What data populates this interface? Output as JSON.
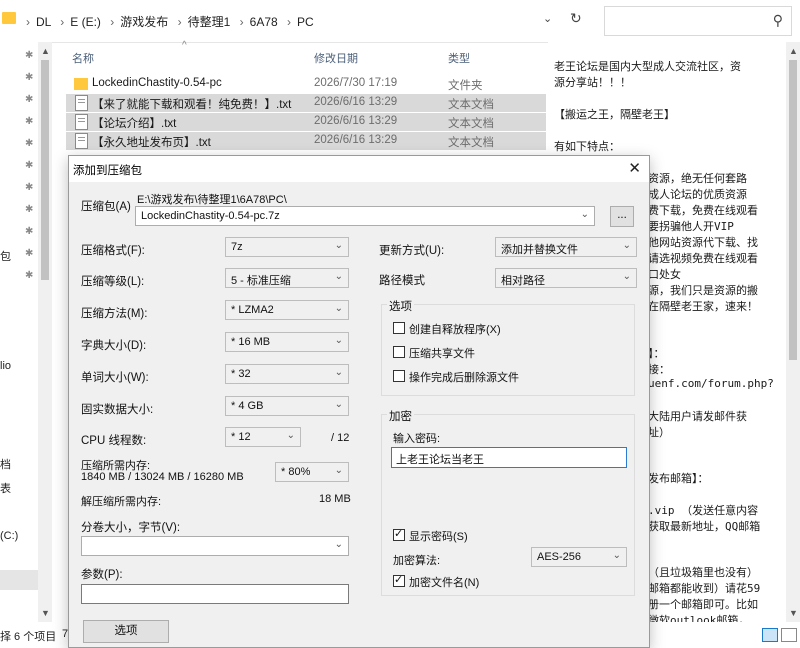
{
  "explorer": {
    "breadcrumb": [
      "DL",
      "E (E:)",
      "游戏发布",
      "待整理1",
      "6A78",
      "PC"
    ],
    "columns": {
      "name": "名称",
      "date": "修改日期",
      "type": "类型"
    },
    "files": [
      {
        "name": "LockedinChastity-0.54-pc",
        "date": "2026/7/30 17:19",
        "type": "文件夹",
        "kind": "folder",
        "selected": false
      },
      {
        "name": "【来了就能下载和观看！纯免费！】.txt",
        "date": "2026/6/16 13:29",
        "type": "文本文档",
        "kind": "txt",
        "selected": true
      },
      {
        "name": "【论坛介绍】.txt",
        "date": "2026/6/16 13:29",
        "type": "文本文档",
        "kind": "txt",
        "selected": true
      },
      {
        "name": "【永久地址发布页】.txt",
        "date": "2026/6/16 13:29",
        "type": "文本文档",
        "kind": "txt",
        "selected": true
      }
    ],
    "left_pane_fragments": [
      "包",
      "lio",
      "档",
      "表",
      "(C:)"
    ],
    "status": {
      "count": "择 6 个项目",
      "extra": "7"
    }
  },
  "preview": {
    "lines": [
      "老王论坛是国内大型成人交流社区，资",
      "源分享站！！！",
      "",
      "【搬运之王，隔壁老王】",
      "",
      "有如下特点：",
      "",
      "资源，绝无任何套路",
      "成人论坛的优质资源",
      "费下载，免费在线观看",
      "要拐骗他人开VIP",
      "他网站资源代下载、找",
      "请选视频免费在线观看",
      "口处女",
      "源，我们只是资源的搬",
      "在隔壁老王家，速来！",
      "",
      "",
      "】：",
      "接：",
      "uenf.com/forum.php?",
      "",
      " 大陆用户请发邮件获",
      "址）",
      "",
      "",
      "发布邮箱】：",
      "",
      ".vip （发送任意内容",
      "获取最新地址，QQ邮箱",
      "",
      "",
      "（且垃圾箱里也没有）",
      "邮箱都能收到）请花59",
      "册一个邮箱即可。比如",
      "微软outlook邮箱，"
    ]
  },
  "dialog": {
    "title": "添加到压缩包",
    "archive_label": "压缩包(A)",
    "archive_path": "E:\\游戏发布\\待整理1\\6A78\\PC\\",
    "archive_name": "LockedinChastity-0.54-pc.7z",
    "browse_label": "...",
    "format_label": "压缩格式(F):",
    "format_value": "7z",
    "level_label": "压缩等级(L):",
    "level_value": "5 - 标准压缩",
    "method_label": "压缩方法(M):",
    "method_value": "* LZMA2",
    "dict_label": "字典大小(D):",
    "dict_value": "* 16 MB",
    "word_label": "单词大小(W):",
    "word_value": "* 32",
    "solid_label": "固实数据大小:",
    "solid_value": "* 4 GB",
    "cpu_label": "CPU 线程数:",
    "cpu_value": "* 12",
    "cpu_max": "/ 12",
    "mem_label": "压缩所需内存:",
    "mem_value": "1840 MB / 13024 MB / 16280 MB",
    "mem_percent": "* 80%",
    "decomp_label": "解压缩所需内存:",
    "decomp_value": "18 MB",
    "volume_label": "分卷大小，字节(V):",
    "volume_value": "",
    "params_label": "参数(P):",
    "params_value": "",
    "options_button": "选项",
    "update_label": "更新方式(U):",
    "update_value": "添加并替换文件",
    "pathmode_label": "路径模式",
    "pathmode_value": "相对路径",
    "options_group": "选项",
    "opt_sfx": "创建自释放程序(X)",
    "opt_shared": "压缩共享文件",
    "opt_delete": "操作完成后删除源文件",
    "encrypt_group": "加密",
    "password_label": "输入密码:",
    "password_value": "上老王论坛当老王",
    "show_password": "显示密码(S)",
    "enc_method_label": "加密算法:",
    "enc_method_value": "AES-256",
    "enc_names": "加密文件名(N)",
    "close_symbol": "✕"
  }
}
